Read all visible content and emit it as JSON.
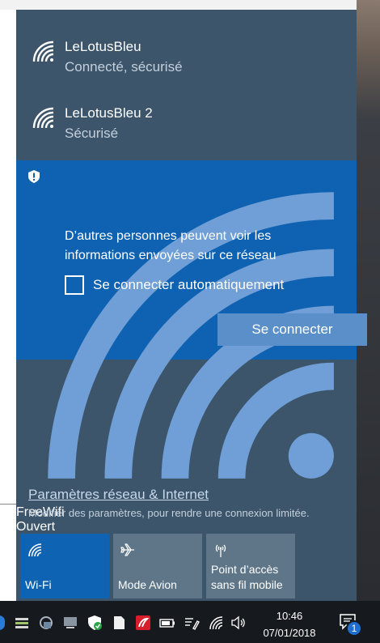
{
  "networks": [
    {
      "name": "LeLotusBleu",
      "status": "Connecté, sécurisé",
      "icon": "wifi-icon"
    },
    {
      "name": "LeLotusBleu 2",
      "status": "Sécurisé",
      "icon": "wifi-icon"
    }
  ],
  "selected_network": {
    "name": "FreeWifi",
    "status": "Ouvert",
    "icon": "wifi-open-warning-icon",
    "warning": "D’autres personnes peuvent voir les informations envoyées sur ce réseau",
    "auto_connect_label": "Se connecter automatiquement",
    "auto_connect_checked": false,
    "connect_button": "Se connecter"
  },
  "settings": {
    "link": "Paramètres réseau & Internet",
    "description": "Modifier des paramètres, pour rendre une connexion limitée."
  },
  "quick_actions": [
    {
      "label": "Wi-Fi",
      "icon": "wifi-icon",
      "active": true
    },
    {
      "label": "Mode Avion",
      "icon": "airplane-icon",
      "active": false
    },
    {
      "label": "Point d’accès sans fil mobile",
      "icon": "hotspot-icon",
      "active": false
    }
  ],
  "taskbar": {
    "time": "10:46",
    "date": "07/01/2018",
    "notification_count": "1",
    "tray_icons": [
      "app-icon",
      "app-icon",
      "app-icon",
      "computer-icon",
      "security-shield-icon",
      "document-icon",
      "antivirus-icon",
      "battery-icon",
      "pen-icon",
      "wifi-icon",
      "volume-icon"
    ]
  },
  "colors": {
    "panel_bg": "#3c556b",
    "selected_bg": "#0f62b1",
    "button_bg": "#5b8fca",
    "tile_active": "#0e63b3",
    "tile_inactive": "#5f7688",
    "taskbar_bg": "#16191d"
  }
}
